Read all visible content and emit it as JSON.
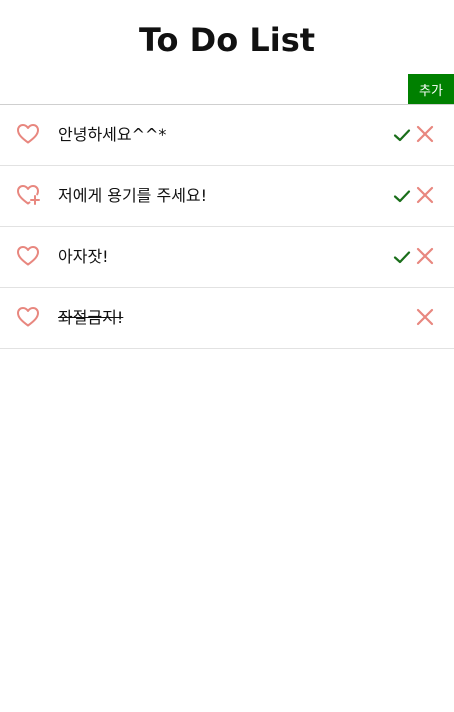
{
  "header": {
    "title": "To Do List"
  },
  "input": {
    "value": "",
    "placeholder": ""
  },
  "add_button": {
    "label": "추가"
  },
  "colors": {
    "accent_green": "#008000",
    "heart": "#e8877f",
    "check": "#1a6e1a",
    "delete": "#e8877f"
  },
  "todos": [
    {
      "text": "안녕하세요^^*",
      "heart_icon": "heart-outline-icon",
      "completed": false
    },
    {
      "text": "저에게 용기를 주세요!",
      "heart_icon": "heart-plus-icon",
      "completed": false
    },
    {
      "text": "아자잣!",
      "heart_icon": "heart-outline-icon",
      "completed": false
    },
    {
      "text": "좌절금지!",
      "heart_icon": "heart-outline-icon",
      "completed": true
    }
  ]
}
